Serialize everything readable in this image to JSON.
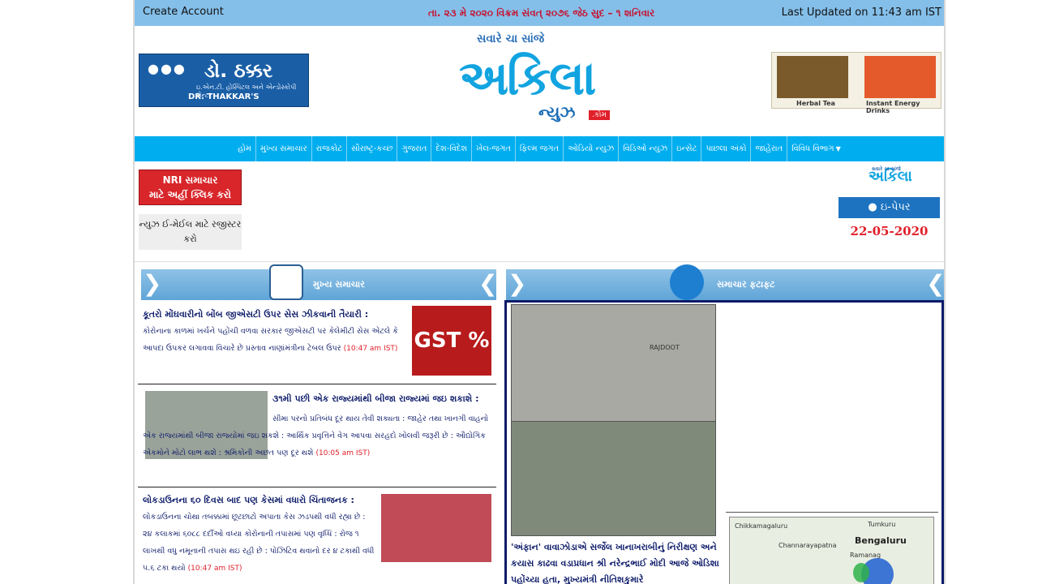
{
  "topbar": {
    "create_account": "Create Account",
    "date_gujarati": "તા. ૨૩ મે ૨૦૨૦ વિક્રમ સંવત્‌ ૨૦૭૬ જેઠ સુદ – ૧ શનિવાર",
    "last_updated": "Last Updated on 11:43 am IST"
  },
  "ads": {
    "left": {
      "name": "ડો. ઠક્કર",
      "sub": "ઇ.એન.ટી. હોસ્પિટલ અને એન્ડોસ્કોપી સેન્ટર",
      "english": "DR. THAKKAR'S"
    },
    "right": {
      "label1": "Herbal Tea",
      "label2": "Instant Energy Drinks"
    }
  },
  "logo": {
    "tagline": "સવારે ચા સાંજે",
    "name": "અકિલા",
    "news": "ન્યુઝ",
    "com": ".કોમ"
  },
  "nav": {
    "items": [
      "હોમ",
      "મુખ્ય સમાચાર",
      "રાજકોટ",
      "સૌરાષ્ટ્ર-કચ્છ",
      "ગુજરાત",
      "દેશ-વિદેશ",
      "ખેલ-જગત",
      "ફિલ્મ જગત",
      "ઓડિયો ન્યુઝ",
      "વિડિઓ ન્યુઝ",
      "ઇન્સેટ",
      "પાછલા અંકો",
      "જાહેરાત",
      "વિવિધ વિભાગ"
    ]
  },
  "nri": {
    "line1": "NRI સમાચાર",
    "line2": "માટે અહીં ક્લિક કરો"
  },
  "register": {
    "line1": "ન્યુઝ ઈ-મેઈલ માટે રજીસ્ટર",
    "line2": "કરો"
  },
  "epaper": {
    "logo_small": "સવારે ચા સાંજે",
    "logo": "અકિલા",
    "button": "ઇ-પેપર",
    "date": "22-05-2020"
  },
  "sections": {
    "left_title": "મુખ્ય સમાચાર",
    "right_title": "સમાચાર ફટાફટ"
  },
  "stories": [
    {
      "headline": "કૂતરો મોંઘવારીનો બોંબ જીએસટી ઉપર સેસ ઝીકવાની તૈયારી :",
      "body": "કોરોનાના કાળમાં ખર્ચને પહોંચી વળવા સરકાર જીએસટી પર કેલેમીટી સેસ એટલે કે આપદા ઉપકર લગાવવા વિચારે છે પ્રસ્તાવ નાણાંમંત્રીના ટેબલ ઉપર",
      "time": "(10:47 am IST)",
      "thumb_label": "GST %"
    },
    {
      "headline": "૩૧મી પછી એક રાજ્યમાંથી બીજા રાજ્યમાં જઇ શકાશે :",
      "body": "સીમા પરનો પ્રતિબંધ દૂર થાય તેવી શક્યતા : જાહેર તથા ખાનગી વાહનો એક રાજ્યમાંથી બીજા રાજ્યોમાં જઇ શકશે : આર્થિક પ્રવૃત્તિને વેગ આપવા સરહદો ખોલવી જરૂરી છે : ઔદ્યોગિક એકમોને મોટો લાભ થશે : શ્રમિકોની અછત પણ દૂર થશે",
      "time": "(10:05 am IST)"
    },
    {
      "headline": "લોકડાઉનના ૬૦ દિવસ બાદ પણ કેસમાં વધારો ચિંતાજનક :",
      "body": "લોકડાઉનના ચોથા તબક્કામાં છૂટછાટો અપાતા કેસ ઝડપથી વધી રહ્યા છે : ૨૪ કલાકમાં ૬૦૮૮ દર્દીઓ વધ્યા કોરોનાની તપાસમાં પણ વૃધ્ધિ : રોજ ૧ લાખથી વધુ નમૂનાની તપાસ થઇ રહી છે : પોઝિટિવ થવાનો દર ૪ ટકાથી વધી ૫.૬ ટકા થયો",
      "time": "(10:47 am IST)"
    }
  ],
  "fatafat": {
    "plane_text": "RAJDOOT",
    "text": "'અંફાન' વાવાઝોડાએ સર્જેલ ખાનાખરાબીનું નિરીક્ષણ અને કયાસ કાઢવા વડાપ્રધાન શ્રી નરેન્દ્રભાઈ મોદી આજે ઓડિશા પહોંચ્યા હતા, મુખ્યમંત્રી નીતિશકુમારે"
  },
  "map": {
    "labels": [
      "Chikkamagaluru",
      "Tumkuru",
      "Bengaluru",
      "Channarayapatna",
      "Ramanag"
    ]
  },
  "colors": {
    "topbar": "#84bfe9",
    "nav": "#00aeef",
    "headline": "#0d1b69",
    "time": "#e0202a"
  }
}
